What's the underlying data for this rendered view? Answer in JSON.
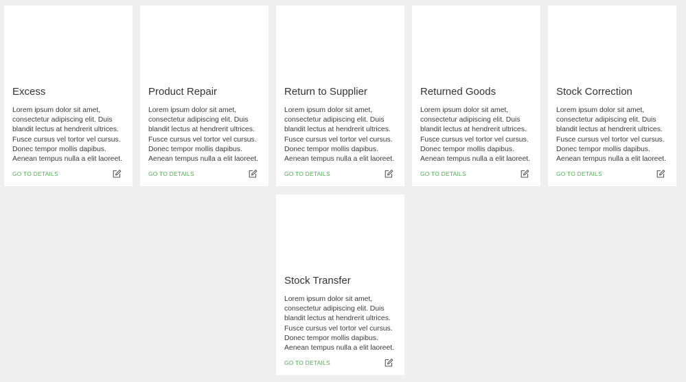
{
  "cards": [
    {
      "title": "Excess",
      "description": "Lorem ipsum dolor sit amet, consectetur adipiscing elit. Duis blandit lectus at hendrerit ultrices. Fusce cursus vel tortor vel cursus. Donec tempor mollis dapibus. Aenean tempus nulla a elit laoreet.",
      "link_label": "GO TO DETAILS",
      "edit_icon": "edit-icon"
    },
    {
      "title": "Product Repair",
      "description": "Lorem ipsum dolor sit amet, consectetur adipiscing elit. Duis blandit lectus at hendrerit ultrices. Fusce cursus vel tortor vel cursus. Donec tempor mollis dapibus. Aenean tempus nulla a elit laoreet.",
      "link_label": "GO TO DETAILS",
      "edit_icon": "edit-icon"
    },
    {
      "title": "Return to Supplier",
      "description": "Lorem ipsum dolor sit amet, consectetur adipiscing elit. Duis blandit lectus at hendrerit ultrices. Fusce cursus vel tortor vel cursus. Donec tempor mollis dapibus. Aenean tempus nulla a elit laoreet.",
      "link_label": "GO TO DETAILS",
      "edit_icon": "edit-icon"
    },
    {
      "title": "Returned Goods",
      "description": "Lorem ipsum dolor sit amet, consectetur adipiscing elit. Duis blandit lectus at hendrerit ultrices. Fusce cursus vel tortor vel cursus. Donec tempor mollis dapibus. Aenean tempus nulla a elit laoreet.",
      "link_label": "GO TO DETAILS",
      "edit_icon": "edit-icon"
    },
    {
      "title": "Stock Correction",
      "description": "Lorem ipsum dolor sit amet, consectetur adipiscing elit. Duis blandit lectus at hendrerit ultrices. Fusce cursus vel tortor vel cursus. Donec tempor mollis dapibus. Aenean tempus nulla a elit laoreet.",
      "link_label": "GO TO DETAILS",
      "edit_icon": "edit-icon"
    },
    {
      "title": "Stock Transfer",
      "description": "Lorem ipsum dolor sit amet, consectetur adipiscing elit. Duis blandit lectus at hendrerit ultrices. Fusce cursus vel tortor vel cursus. Donec tempor mollis dapibus. Aenean tempus nulla a elit laoreet.",
      "link_label": "GO TO DETAILS",
      "edit_icon": "edit-icon"
    }
  ],
  "colors": {
    "background": "#efefef",
    "card": "#ffffff",
    "link": "#4caf50",
    "title": "#333333",
    "text": "#3a3a3a"
  }
}
